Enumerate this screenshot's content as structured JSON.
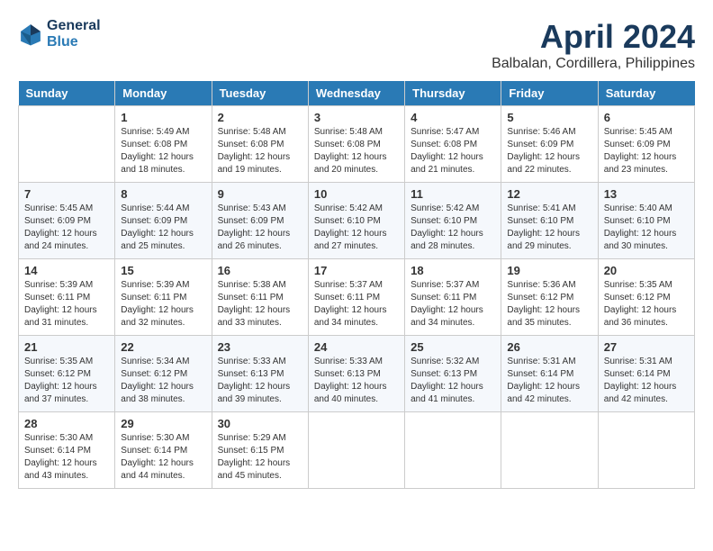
{
  "header": {
    "logo_line1": "General",
    "logo_line2": "Blue",
    "month_title": "April 2024",
    "subtitle": "Balbalan, Cordillera, Philippines"
  },
  "days_of_week": [
    "Sunday",
    "Monday",
    "Tuesday",
    "Wednesday",
    "Thursday",
    "Friday",
    "Saturday"
  ],
  "weeks": [
    [
      {
        "day": "",
        "sunrise": "",
        "sunset": "",
        "daylight": ""
      },
      {
        "day": "1",
        "sunrise": "Sunrise: 5:49 AM",
        "sunset": "Sunset: 6:08 PM",
        "daylight": "Daylight: 12 hours and 18 minutes."
      },
      {
        "day": "2",
        "sunrise": "Sunrise: 5:48 AM",
        "sunset": "Sunset: 6:08 PM",
        "daylight": "Daylight: 12 hours and 19 minutes."
      },
      {
        "day": "3",
        "sunrise": "Sunrise: 5:48 AM",
        "sunset": "Sunset: 6:08 PM",
        "daylight": "Daylight: 12 hours and 20 minutes."
      },
      {
        "day": "4",
        "sunrise": "Sunrise: 5:47 AM",
        "sunset": "Sunset: 6:08 PM",
        "daylight": "Daylight: 12 hours and 21 minutes."
      },
      {
        "day": "5",
        "sunrise": "Sunrise: 5:46 AM",
        "sunset": "Sunset: 6:09 PM",
        "daylight": "Daylight: 12 hours and 22 minutes."
      },
      {
        "day": "6",
        "sunrise": "Sunrise: 5:45 AM",
        "sunset": "Sunset: 6:09 PM",
        "daylight": "Daylight: 12 hours and 23 minutes."
      }
    ],
    [
      {
        "day": "7",
        "sunrise": "Sunrise: 5:45 AM",
        "sunset": "Sunset: 6:09 PM",
        "daylight": "Daylight: 12 hours and 24 minutes."
      },
      {
        "day": "8",
        "sunrise": "Sunrise: 5:44 AM",
        "sunset": "Sunset: 6:09 PM",
        "daylight": "Daylight: 12 hours and 25 minutes."
      },
      {
        "day": "9",
        "sunrise": "Sunrise: 5:43 AM",
        "sunset": "Sunset: 6:09 PM",
        "daylight": "Daylight: 12 hours and 26 minutes."
      },
      {
        "day": "10",
        "sunrise": "Sunrise: 5:42 AM",
        "sunset": "Sunset: 6:10 PM",
        "daylight": "Daylight: 12 hours and 27 minutes."
      },
      {
        "day": "11",
        "sunrise": "Sunrise: 5:42 AM",
        "sunset": "Sunset: 6:10 PM",
        "daylight": "Daylight: 12 hours and 28 minutes."
      },
      {
        "day": "12",
        "sunrise": "Sunrise: 5:41 AM",
        "sunset": "Sunset: 6:10 PM",
        "daylight": "Daylight: 12 hours and 29 minutes."
      },
      {
        "day": "13",
        "sunrise": "Sunrise: 5:40 AM",
        "sunset": "Sunset: 6:10 PM",
        "daylight": "Daylight: 12 hours and 30 minutes."
      }
    ],
    [
      {
        "day": "14",
        "sunrise": "Sunrise: 5:39 AM",
        "sunset": "Sunset: 6:11 PM",
        "daylight": "Daylight: 12 hours and 31 minutes."
      },
      {
        "day": "15",
        "sunrise": "Sunrise: 5:39 AM",
        "sunset": "Sunset: 6:11 PM",
        "daylight": "Daylight: 12 hours and 32 minutes."
      },
      {
        "day": "16",
        "sunrise": "Sunrise: 5:38 AM",
        "sunset": "Sunset: 6:11 PM",
        "daylight": "Daylight: 12 hours and 33 minutes."
      },
      {
        "day": "17",
        "sunrise": "Sunrise: 5:37 AM",
        "sunset": "Sunset: 6:11 PM",
        "daylight": "Daylight: 12 hours and 34 minutes."
      },
      {
        "day": "18",
        "sunrise": "Sunrise: 5:37 AM",
        "sunset": "Sunset: 6:11 PM",
        "daylight": "Daylight: 12 hours and 34 minutes."
      },
      {
        "day": "19",
        "sunrise": "Sunrise: 5:36 AM",
        "sunset": "Sunset: 6:12 PM",
        "daylight": "Daylight: 12 hours and 35 minutes."
      },
      {
        "day": "20",
        "sunrise": "Sunrise: 5:35 AM",
        "sunset": "Sunset: 6:12 PM",
        "daylight": "Daylight: 12 hours and 36 minutes."
      }
    ],
    [
      {
        "day": "21",
        "sunrise": "Sunrise: 5:35 AM",
        "sunset": "Sunset: 6:12 PM",
        "daylight": "Daylight: 12 hours and 37 minutes."
      },
      {
        "day": "22",
        "sunrise": "Sunrise: 5:34 AM",
        "sunset": "Sunset: 6:12 PM",
        "daylight": "Daylight: 12 hours and 38 minutes."
      },
      {
        "day": "23",
        "sunrise": "Sunrise: 5:33 AM",
        "sunset": "Sunset: 6:13 PM",
        "daylight": "Daylight: 12 hours and 39 minutes."
      },
      {
        "day": "24",
        "sunrise": "Sunrise: 5:33 AM",
        "sunset": "Sunset: 6:13 PM",
        "daylight": "Daylight: 12 hours and 40 minutes."
      },
      {
        "day": "25",
        "sunrise": "Sunrise: 5:32 AM",
        "sunset": "Sunset: 6:13 PM",
        "daylight": "Daylight: 12 hours and 41 minutes."
      },
      {
        "day": "26",
        "sunrise": "Sunrise: 5:31 AM",
        "sunset": "Sunset: 6:14 PM",
        "daylight": "Daylight: 12 hours and 42 minutes."
      },
      {
        "day": "27",
        "sunrise": "Sunrise: 5:31 AM",
        "sunset": "Sunset: 6:14 PM",
        "daylight": "Daylight: 12 hours and 42 minutes."
      }
    ],
    [
      {
        "day": "28",
        "sunrise": "Sunrise: 5:30 AM",
        "sunset": "Sunset: 6:14 PM",
        "daylight": "Daylight: 12 hours and 43 minutes."
      },
      {
        "day": "29",
        "sunrise": "Sunrise: 5:30 AM",
        "sunset": "Sunset: 6:14 PM",
        "daylight": "Daylight: 12 hours and 44 minutes."
      },
      {
        "day": "30",
        "sunrise": "Sunrise: 5:29 AM",
        "sunset": "Sunset: 6:15 PM",
        "daylight": "Daylight: 12 hours and 45 minutes."
      },
      {
        "day": "",
        "sunrise": "",
        "sunset": "",
        "daylight": ""
      },
      {
        "day": "",
        "sunrise": "",
        "sunset": "",
        "daylight": ""
      },
      {
        "day": "",
        "sunrise": "",
        "sunset": "",
        "daylight": ""
      },
      {
        "day": "",
        "sunrise": "",
        "sunset": "",
        "daylight": ""
      }
    ]
  ]
}
